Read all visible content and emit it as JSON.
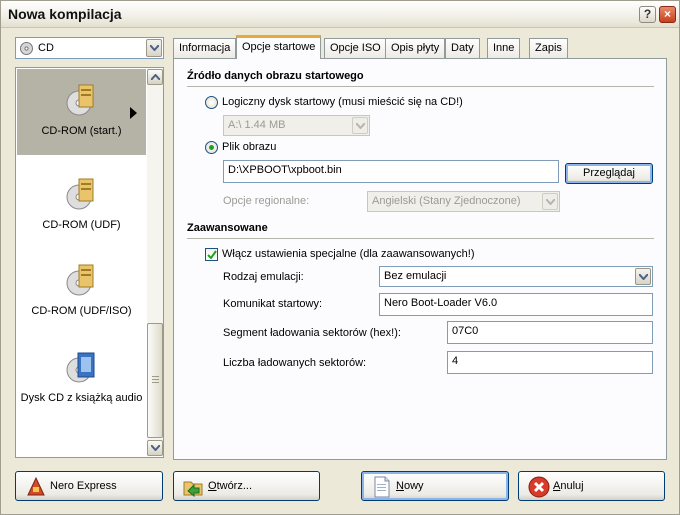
{
  "window": {
    "title": "Nowa kompilacja",
    "help_glyph": "?",
    "close_glyph": "×"
  },
  "disc_type": {
    "value": "CD"
  },
  "categories": [
    {
      "label": "CD-ROM (start.)",
      "icon": "cd-rom-boot-icon",
      "selected": true
    },
    {
      "label": "CD-ROM (UDF)",
      "icon": "cd-rom-udf-icon",
      "selected": false
    },
    {
      "label": "CD-ROM (UDF/ISO)",
      "icon": "cd-rom-udf-iso-icon",
      "selected": false
    },
    {
      "label": "Dysk CD z książką audio",
      "icon": "cd-audiobook-icon",
      "selected": false
    }
  ],
  "tabs": [
    {
      "label": "Informacja"
    },
    {
      "label": "Opcje startowe",
      "active": true
    },
    {
      "label": "Opcje ISO"
    },
    {
      "label": "Opis płyty"
    },
    {
      "label": "Daty"
    },
    {
      "label": "Inne"
    },
    {
      "label": "Zapis"
    }
  ],
  "boot_source": {
    "title": "Źródło danych obrazu startowego",
    "logical_drive_label": "Logiczny dysk startowy (musi mieścić się na CD!)",
    "logical_drive_value": "A:\\  1.44 MB",
    "image_file_label": "Plik obrazu",
    "image_path": "D:\\XPBOOT\\xpboot.bin",
    "browse_label": "Przeglądaj",
    "regional_label": "Opcje regionalne:",
    "regional_value": "Angielski (Stany Zjednoczone)",
    "selected": "image_file"
  },
  "advanced": {
    "title": "Zaawansowane",
    "enable_label": "Włącz ustawienia specjalne (dla zaawansowanych!)",
    "enable_checked": true,
    "emulation_label": "Rodzaj emulacji:",
    "emulation_value": "Bez emulacji",
    "boot_message_label": "Komunikat startowy:",
    "boot_message_value": "Nero Boot-Loader V6.0",
    "load_segment_label": "Segment ładowania sektorów (hex!):",
    "load_segment_value": "07C0",
    "sector_count_label": "Liczba ładowanych sektorów:",
    "sector_count_value": "4"
  },
  "footer": {
    "nero_express": "Nero Express",
    "open_prefix": "O",
    "open_rest": "twórz...",
    "new_prefix": "N",
    "new_rest": "owy",
    "cancel_prefix": "A",
    "cancel_rest": "nuluj"
  },
  "colors": {
    "accent_tab": "#e9a83a",
    "selection": "#b5b2a6",
    "window_bg": "#ece9d8"
  }
}
